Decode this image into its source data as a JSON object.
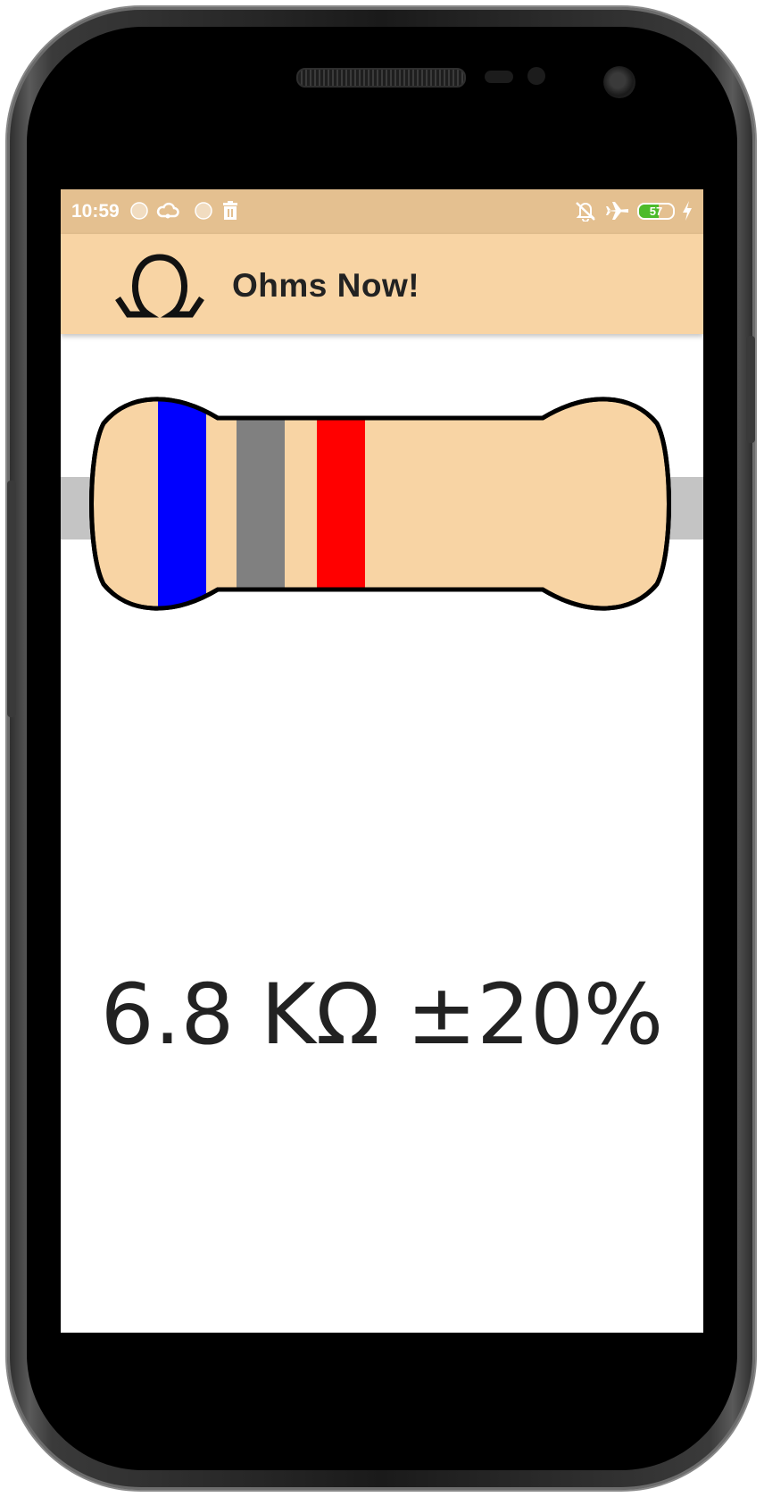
{
  "status_bar": {
    "time": "10:59",
    "battery_level": "57",
    "battery_fraction": 0.57,
    "left_icons": [
      "notification-dot-icon",
      "cloud-icon",
      "notification-dot-icon",
      "trash-icon"
    ],
    "right_icons": [
      "bell-off-icon",
      "airplane-icon",
      "battery-icon",
      "charging-bolt-icon"
    ]
  },
  "app_bar": {
    "logo": "Ω",
    "title": "Ohms Now!"
  },
  "resistor": {
    "body_color": "#f8d4a4",
    "lead_color": "#c4c4c4",
    "bands": [
      {
        "name": "first-digit",
        "color": "#0000ff",
        "label": "blue"
      },
      {
        "name": "second-digit",
        "color": "#808080",
        "label": "gray"
      },
      {
        "name": "multiplier",
        "color": "#ff0000",
        "label": "red"
      }
    ]
  },
  "result": {
    "value_text": "6.8 KΩ ±20%"
  },
  "colors": {
    "status_bar": "#e4c090",
    "app_bar": "#f8d4a4",
    "text": "#222222"
  }
}
